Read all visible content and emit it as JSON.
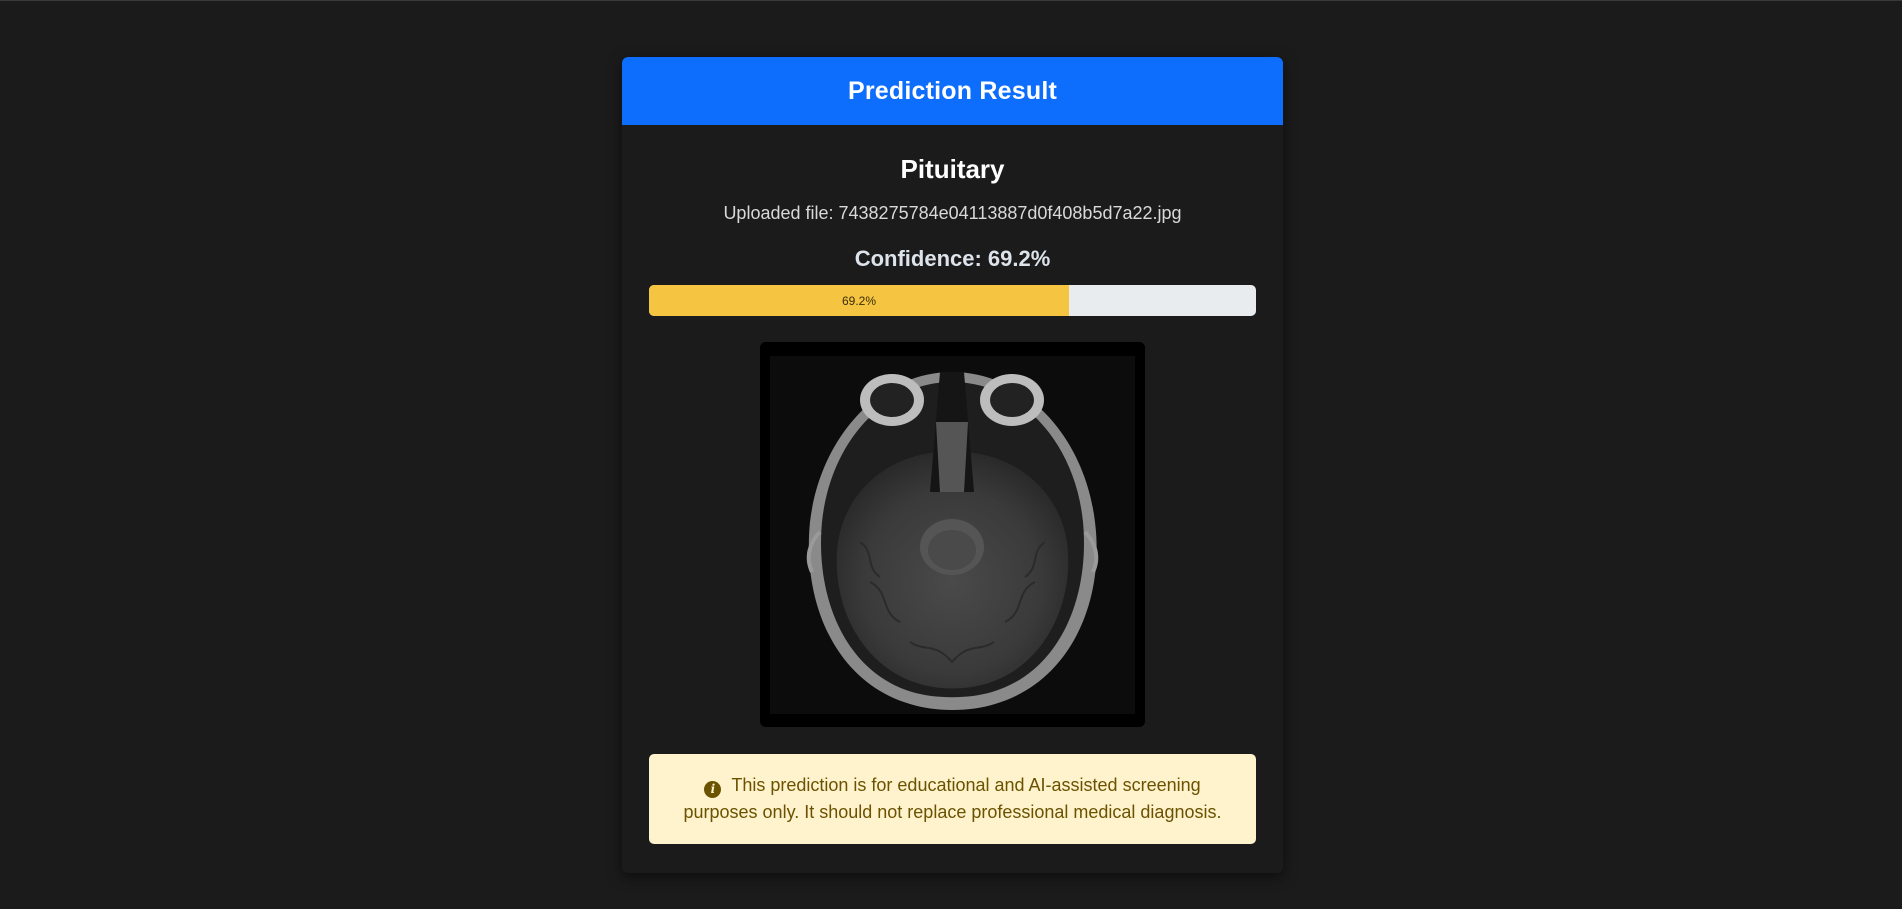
{
  "header": {
    "title": "Prediction Result"
  },
  "result": {
    "predicted_class": "Pituitary",
    "uploaded_file": "Uploaded file: 7438275784e04113887d0f408b5d7a22.jpg",
    "confidence_label": "Confidence: 69.2%",
    "confidence_bar_text": "69.2%",
    "confidence_value": 0.692
  },
  "image": {
    "name": "mri-scan-image"
  },
  "alert": {
    "icon": "info-icon",
    "text": "This prediction is for educational and AI-assisted screening purposes only. It should not replace professional medical diagnosis."
  },
  "colors": {
    "header_bg": "#0d6efd",
    "page_bg": "#1b1b1b",
    "progress_fill": "#f5c542",
    "progress_track": "#e9ecef",
    "alert_bg": "#fff3cd",
    "alert_text": "#6b5200"
  }
}
